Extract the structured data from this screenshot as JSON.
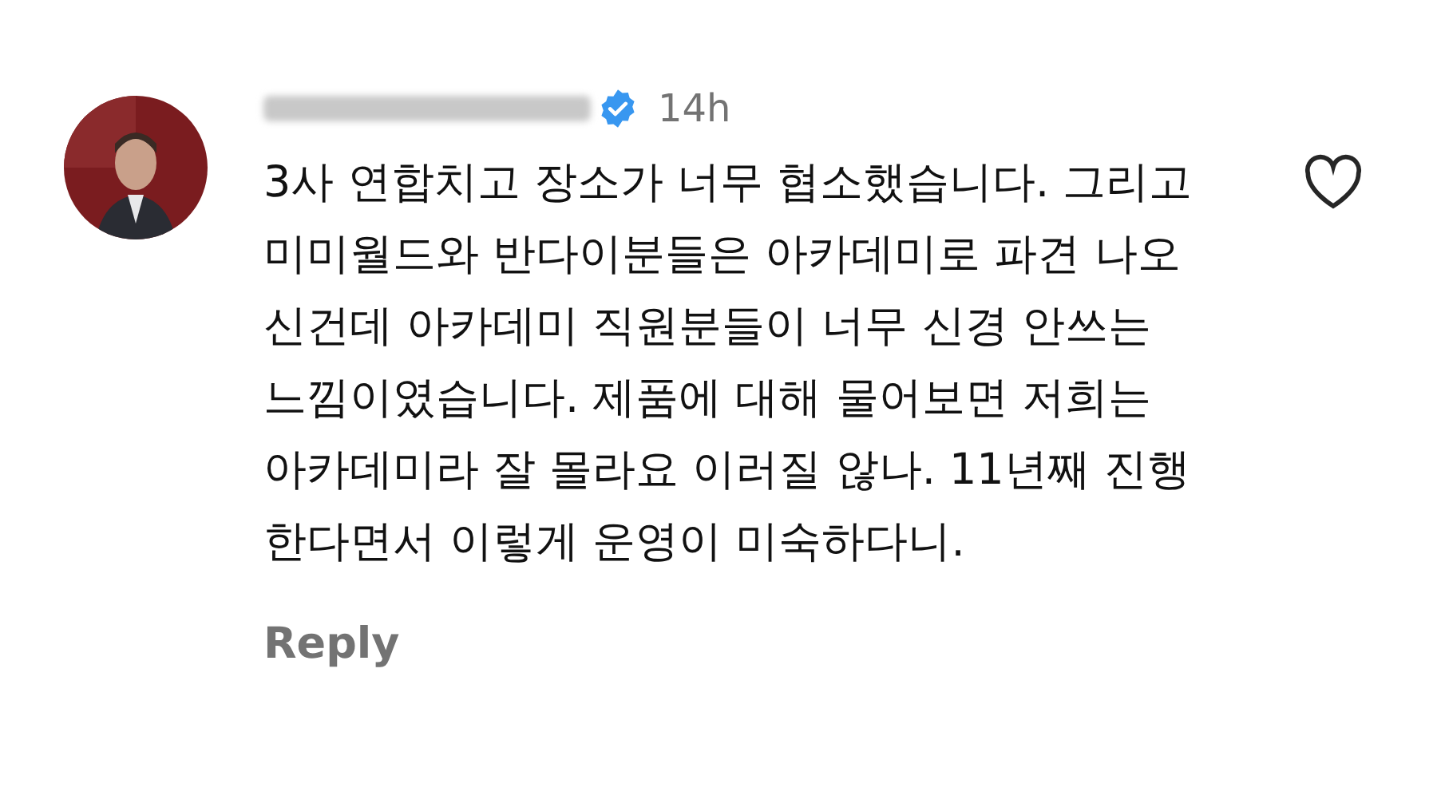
{
  "comment": {
    "verified": true,
    "time": "14h",
    "text": "3사 연합치고 장소가 너무 협소했습니다. 그리고 미미월드와 반다이분들은 아카데미로 파견 나오신건데 아카데미 직원분들이 너무 신경 안쓰는 느낌이였습니다. 제품에 대해 물어보면 저희는 아카데미라 잘 몰라요 이러질 않나. 11년째 진행한다면서 이렇게 운영이 미숙하다니.",
    "liked": false,
    "reply": "Reply"
  }
}
